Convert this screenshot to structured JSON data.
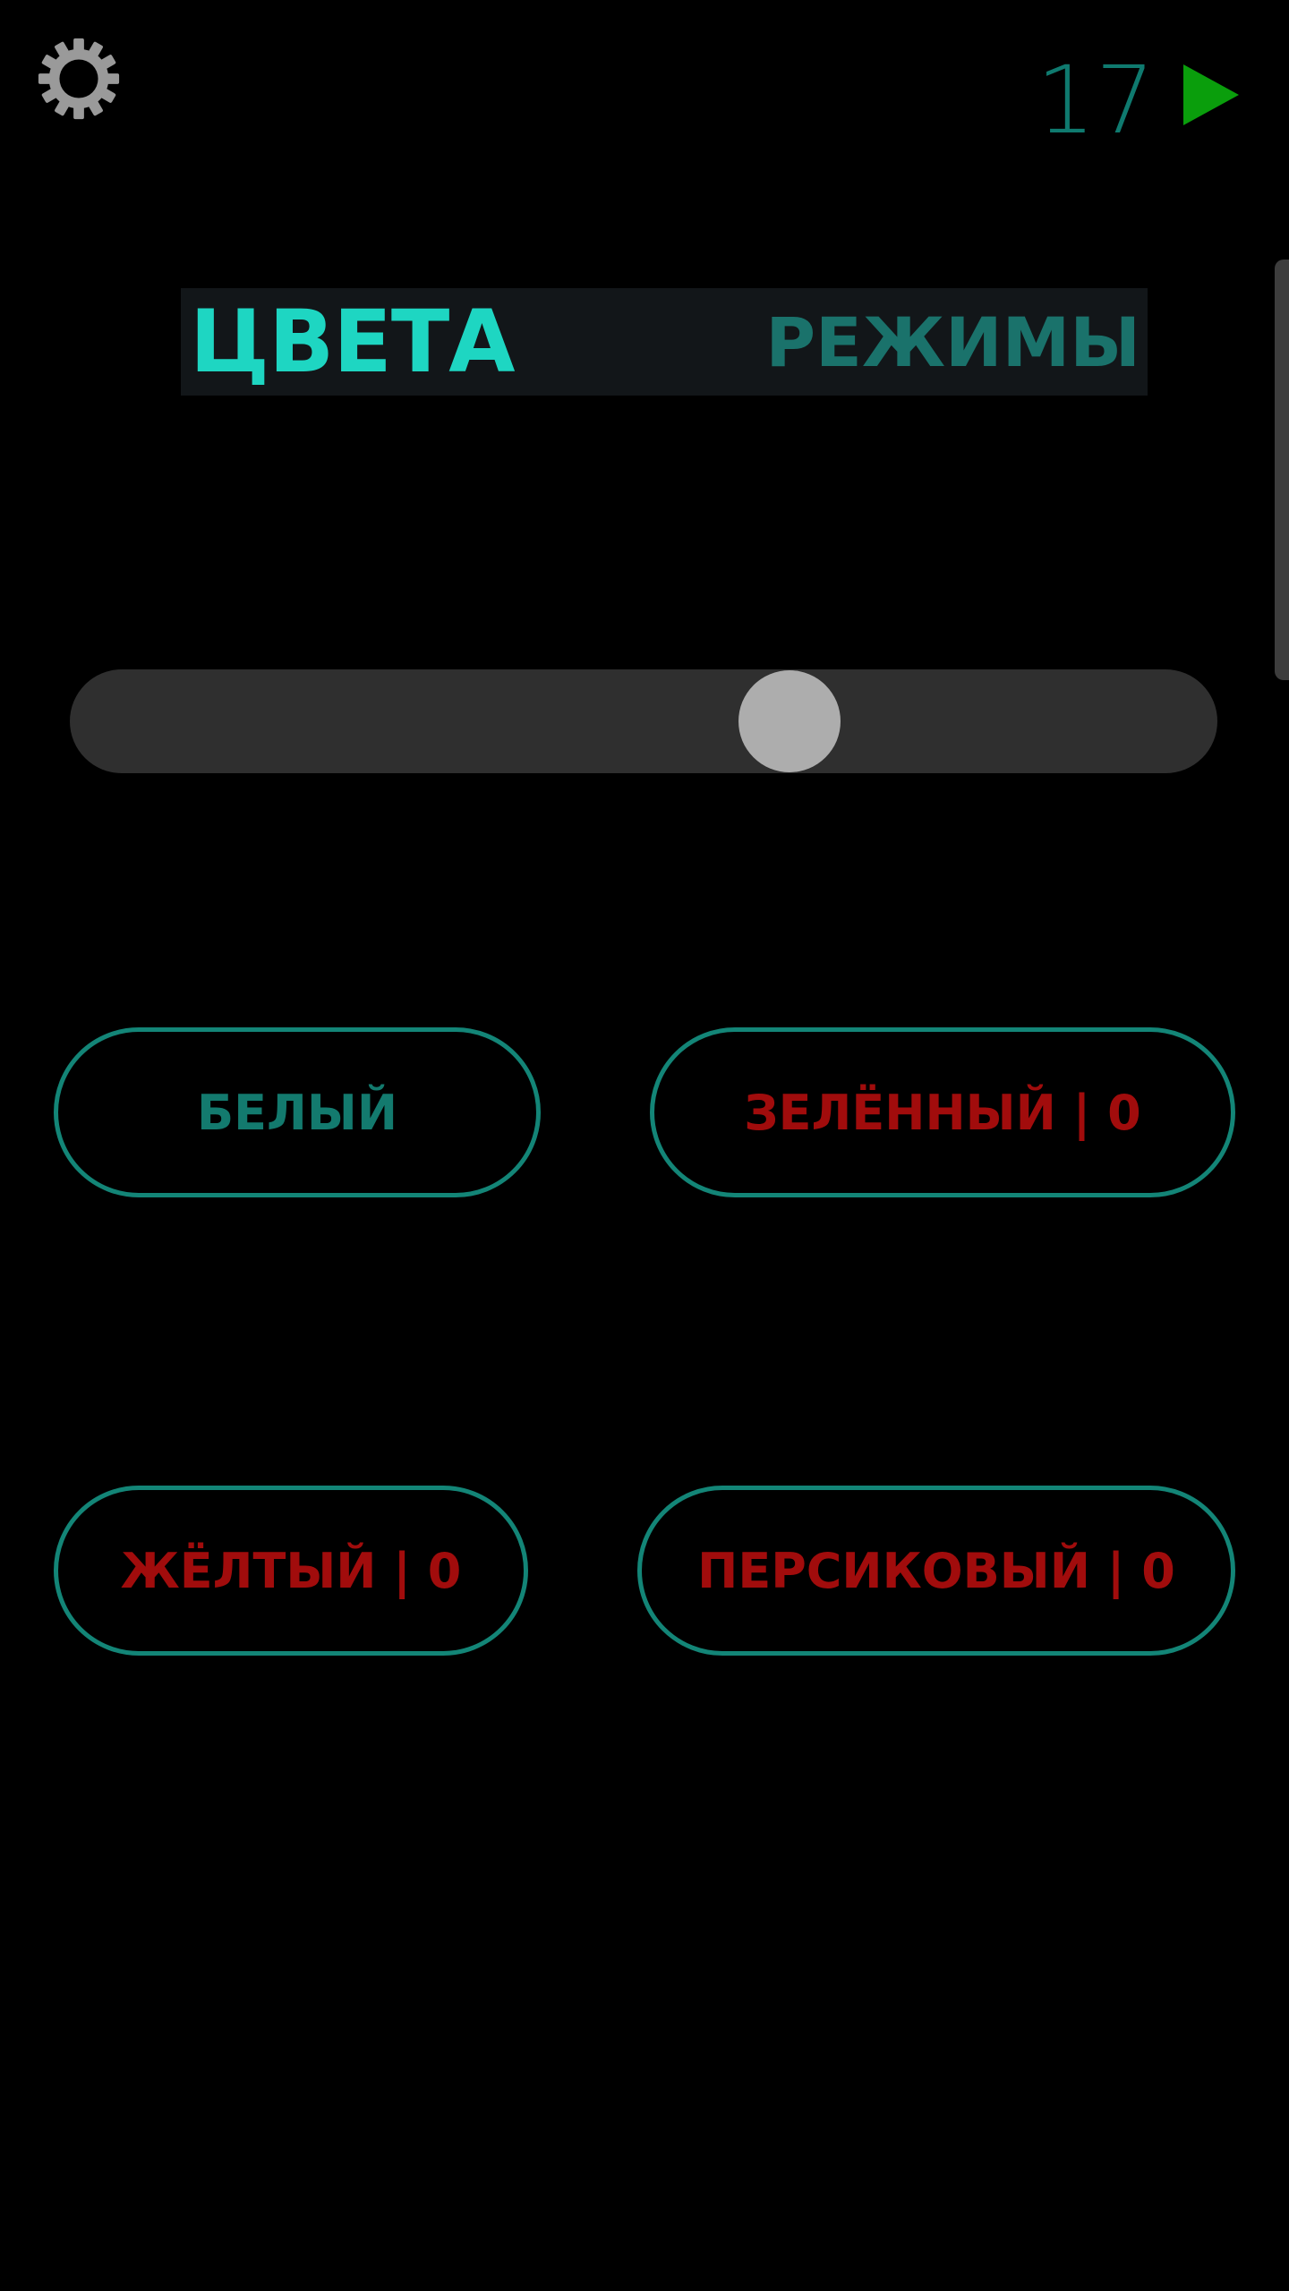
{
  "header": {
    "settings_icon": "gear-icon",
    "counter": "17",
    "play_icon": "play-icon"
  },
  "tabs": [
    {
      "label": "ЦВЕТА",
      "active": true
    },
    {
      "label": "РЕЖИМЫ",
      "active": false
    }
  ],
  "slider": {
    "value": 0.627
  },
  "buttons": [
    {
      "label": "БЕЛЫЙ",
      "unlocked": true
    },
    {
      "label": "ЗЕЛЁННЫЙ | 0",
      "unlocked": false
    },
    {
      "label": "ЖЁЛТЫЙ | 0",
      "unlocked": false
    },
    {
      "label": "ПЕРСИКОВЫЙ | 0",
      "unlocked": false
    }
  ],
  "colors": {
    "background": "#000000",
    "counter": "#0f7a6f",
    "tab_active": "#1ed6c2",
    "tab_inactive": "#1a726b",
    "tab_bar": "#121619",
    "play": "#0a9e0c",
    "gear": "#9a9a9a",
    "button_border": "#138577",
    "unlocked_text": "#137a6e",
    "locked_text": "#a10c0c",
    "slider_track": "#2f2f2f",
    "slider_thumb": "#adadad"
  }
}
